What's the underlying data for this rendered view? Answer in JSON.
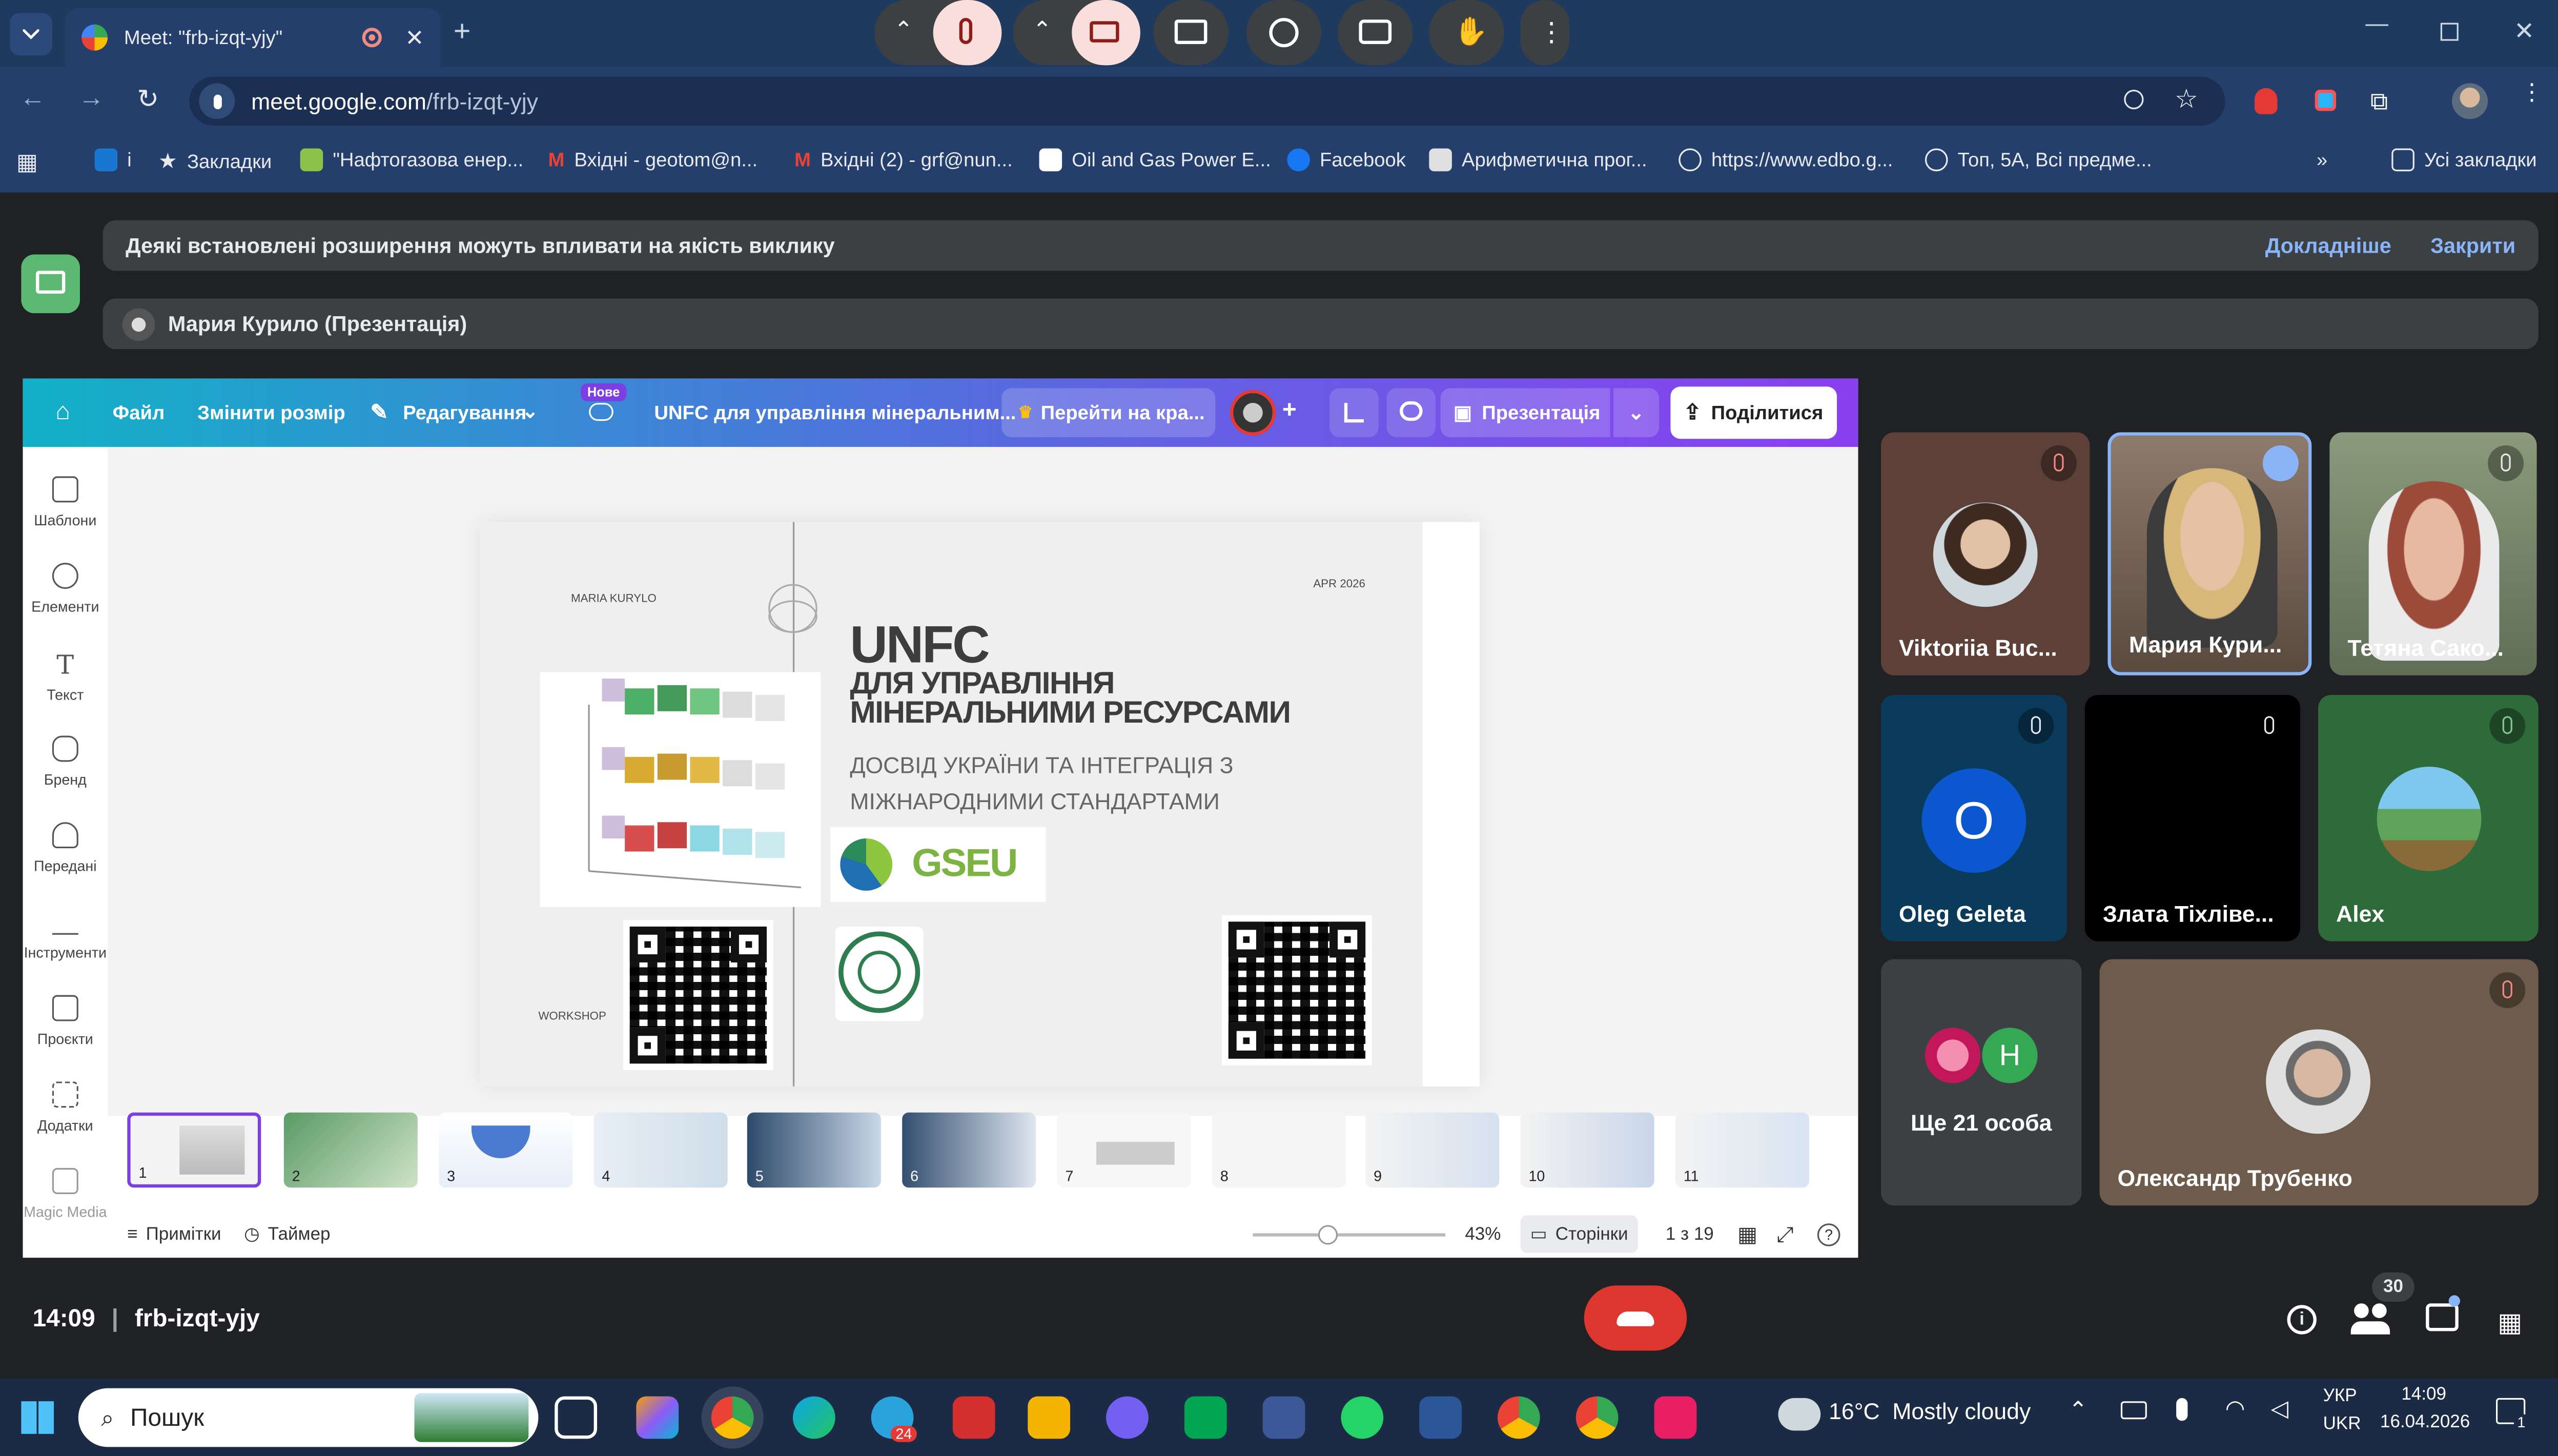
{
  "browser": {
    "tab_title": "Meet: \"frb-izqt-yjy\"",
    "url_host": "meet.google.com",
    "url_path": "/frb-izqt-yjy",
    "bookmarks": [
      "i",
      "Закладки",
      "\"Нафтогазова енер...",
      "Вхідні - geotom@n...",
      "Вхідні (2) - grf@nun...",
      "Oil and Gas Power E...",
      "Facebook",
      "Арифметична прог...",
      "https://www.edbo.g...",
      "Топ, 5А, Всі предме..."
    ],
    "all_bookmarks": "Усі закладки"
  },
  "banners": {
    "extension_warning": "Деякі встановлені розширення можуть впливати на якість виклику",
    "learn_more": "Докладніше",
    "close": "Закрити",
    "presenter": "Мария Курило (Презентація)"
  },
  "canva": {
    "toolbar": {
      "file": "Файл",
      "resize": "Змінити розмір",
      "editing": "Редагування",
      "new_badge": "Нове",
      "doc_title": "UNFC для управління мінеральним...",
      "upgrade": "Перейти на кра...",
      "present": "Презентація",
      "share": "Поділитися"
    },
    "sidebar": [
      "Шаблони",
      "Елементи",
      "Текст",
      "Бренд",
      "Передані",
      "Інструменти",
      "Проєкти",
      "Додатки",
      "Magic Media"
    ],
    "slide": {
      "author": "MARIA KURYLO",
      "date": "APR 2026",
      "title1": "UNFC",
      "title2": "ДЛЯ УПРАВЛІННЯ",
      "title3": "МІНЕРАЛЬНИМИ РЕСУРСАМИ",
      "subtitle1": "ДОСВІД УКРАЇНИ ТА ІНТЕГРАЦІЯ З",
      "subtitle2": "МІЖНАРОДНИМИ СТАНДАРТАМИ",
      "logo": "GSEU",
      "workshop": "WORKSHOP"
    },
    "thumbs": [
      "1",
      "2",
      "3",
      "4",
      "5",
      "6",
      "7",
      "8",
      "9",
      "10",
      "11"
    ],
    "bottom": {
      "notes": "Примітки",
      "timer": "Таймер",
      "zoom": "43%",
      "pages": "Сторінки",
      "page_count": "1 з 19"
    }
  },
  "participants": [
    {
      "name": "Viktoriia Buc...",
      "muted": true
    },
    {
      "name": "Мария Кури...",
      "muted": false,
      "speaking": true
    },
    {
      "name": "Тетяна Сако...",
      "muted": true
    },
    {
      "name": "Oleg Geleta",
      "initial": "O",
      "muted": true
    },
    {
      "name": "Злата Тіхліве...",
      "muted": true
    },
    {
      "name": "Alex",
      "muted": true
    },
    {
      "name": "Ще 21 особа",
      "initial": "H"
    },
    {
      "name": "Олександр Трубенко",
      "muted": true
    }
  ],
  "footer": {
    "time": "14:09",
    "meeting_code": "frb-izqt-yjy",
    "people_badge": "30"
  },
  "taskbar": {
    "search": "Пошук",
    "weather_temp": "16°C",
    "weather_text": "Mostly cloudy",
    "lang1": "УКР",
    "lang2": "UKR",
    "clock_time": "14:09",
    "clock_date": "16.04.2026",
    "tg_badge": "24",
    "notif": "1"
  },
  "colors": {
    "accent_blue": "#8ab4f8",
    "end_call": "#dc362e",
    "mic_off": "#f9dedc"
  }
}
